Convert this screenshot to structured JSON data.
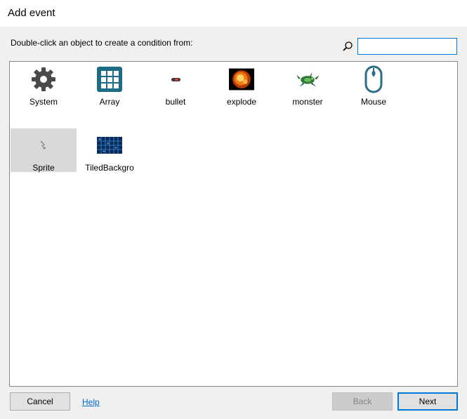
{
  "window": {
    "title": "Add event"
  },
  "prompt": "Double-click an object to create a condition from:",
  "search": {
    "value": "",
    "placeholder": ""
  },
  "objects": [
    {
      "label": "System",
      "icon": "gear-icon",
      "selected": false
    },
    {
      "label": "Array",
      "icon": "grid-icon",
      "selected": false
    },
    {
      "label": "bullet",
      "icon": "bullet-icon",
      "selected": false
    },
    {
      "label": "explode",
      "icon": "explosion-icon",
      "selected": false
    },
    {
      "label": "monster",
      "icon": "monster-icon",
      "selected": false
    },
    {
      "label": "Mouse",
      "icon": "mouse-icon",
      "selected": false
    },
    {
      "label": "Sprite",
      "icon": "sprite-icon",
      "selected": true
    },
    {
      "label": "TiledBackgro",
      "icon": "tiled-background-icon",
      "selected": false
    }
  ],
  "buttons": {
    "cancel": "Cancel",
    "help": "Help",
    "back": "Back",
    "next": "Next"
  },
  "colors": {
    "accent": "#0078d7",
    "selection": "#d9d9d9",
    "link": "#0066cc"
  }
}
